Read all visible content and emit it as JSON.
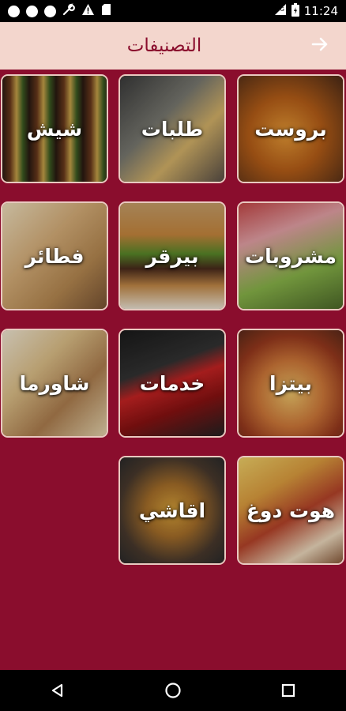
{
  "status_bar": {
    "time": "11:24",
    "left_icons": [
      "notification-dot-icon",
      "notification-dot-icon",
      "notification-dot-icon",
      "wrench-icon",
      "warning-icon",
      "sd-card-icon"
    ],
    "right_icons": [
      "signal-icon",
      "battery-icon"
    ]
  },
  "header": {
    "title": "التصنيفات",
    "back_icon": "arrow-right-icon",
    "background": "#f3d6cd",
    "title_color": "#8a0d2d"
  },
  "page": {
    "background": "#8a0d2d"
  },
  "categories": [
    {
      "label": "بروست"
    },
    {
      "label": "طلبات"
    },
    {
      "label": "شيش"
    },
    {
      "label": "مشروبات"
    },
    {
      "label": "بيرقر"
    },
    {
      "label": "فطائر"
    },
    {
      "label": "بيتزا"
    },
    {
      "label": "خدمات"
    },
    {
      "label": "شاورما"
    },
    {
      "label": "هوت دوغ"
    },
    {
      "label": "اقاشي"
    }
  ],
  "nav_bar": {
    "icons": [
      "back-triangle-icon",
      "home-circle-icon",
      "recents-square-icon"
    ]
  }
}
